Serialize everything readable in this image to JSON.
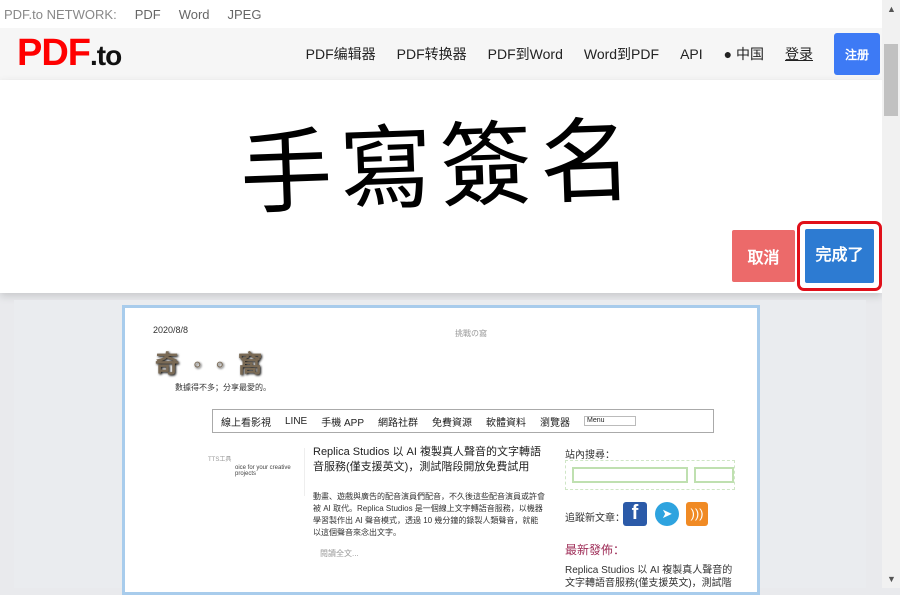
{
  "network": {
    "label": "PDF.to NETWORK:",
    "links": [
      "PDF",
      "Word",
      "JPEG"
    ]
  },
  "header": {
    "logo_main": "PDF",
    "logo_suffix": ".to",
    "nav": [
      "PDF编辑器",
      "PDF转换器",
      "PDF到Word",
      "Word到PDF",
      "API"
    ],
    "region": "中国",
    "login": "登录",
    "register": "注册"
  },
  "signature": {
    "text": "手寫簽名",
    "cancel": "取消",
    "done": "完成了"
  },
  "doc": {
    "date": "2020/8/8",
    "site_center": "挑戰の窩",
    "tagline": "數據得不多；分享最愛的。",
    "menu": [
      "線上看影視",
      "LINE",
      "手機 APP",
      "網路社群",
      "免費資源",
      "軟體資料",
      "瀏覽器"
    ],
    "menu_select": "Menu",
    "thumb_title": "TTS工具",
    "thumb_text": "oice for your creative projects",
    "article_title": "Replica Studios 以 AI 複製真人聲音的文字轉語音服務(僅支援英文)，測試階段開放免費試用",
    "article_body": "動畫、遊戲與廣告的配音演員們配音，不久後這些配音演員或許會被 AI 取代。Replica Studios 是一個線上文字轉語音服務，以機器學習製作出 AI 聲音模式，透過 10 幾分鐘的錄製人類聲音，就能以這個聲音來念出文字。",
    "read_more": "閱讀全文...",
    "search_label": "站內搜尋：",
    "follow_label": "追蹤新文章：",
    "latest_label": "最新發佈：",
    "latest_item": "Replica Studios 以 AI 複製真人聲音的文字轉語音服務(僅支援英文)，測試階",
    "colors": {
      "latest": "#a0305a"
    }
  }
}
